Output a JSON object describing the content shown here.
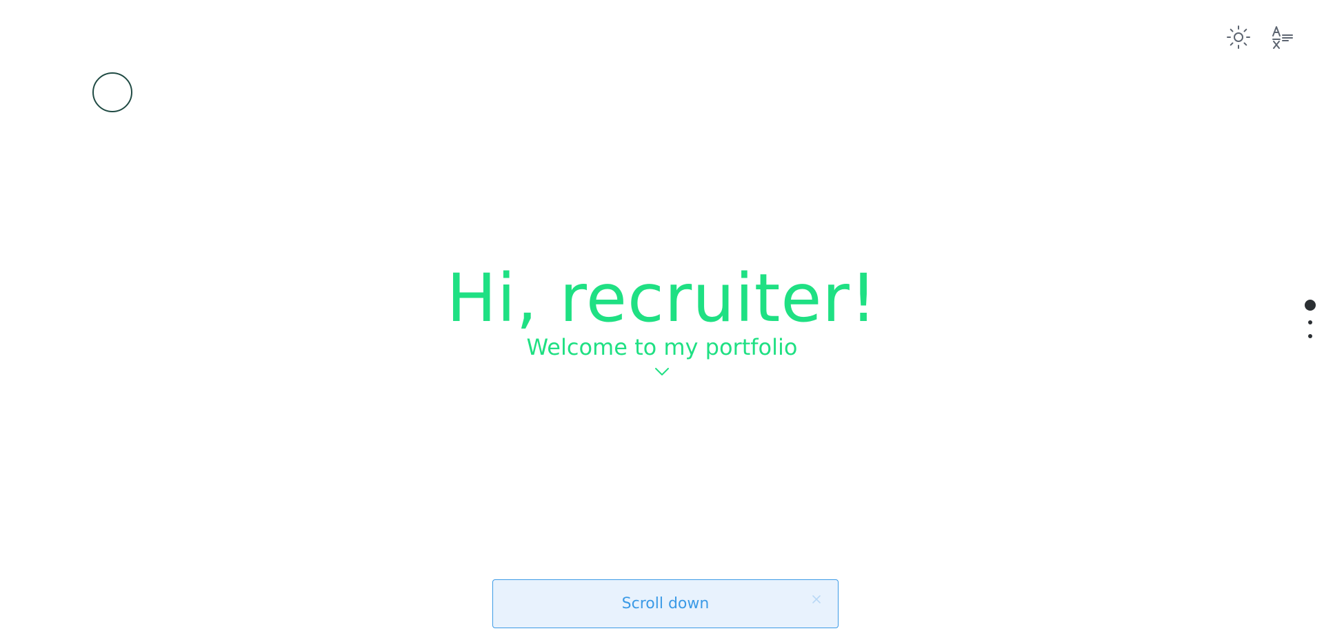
{
  "header": {
    "theme_toggle_icon": "sun-icon",
    "language_icon": "translate-icon",
    "logo_icon": "circle-logo-icon"
  },
  "hero": {
    "title": "Hi, recruiter!",
    "subtitle": "Welcome to my portfolio",
    "scroll_icon": "chevron-down-icon"
  },
  "section_nav": {
    "active_index": 0,
    "count": 3
  },
  "toast": {
    "message": "Scroll down",
    "close_icon": "close-icon"
  },
  "colors": {
    "accent": "#1fe083",
    "toast_text": "#3b9ae6",
    "toast_bg": "#e8f2fd",
    "icon": "#5c6470",
    "dot": "#2b2f33"
  }
}
